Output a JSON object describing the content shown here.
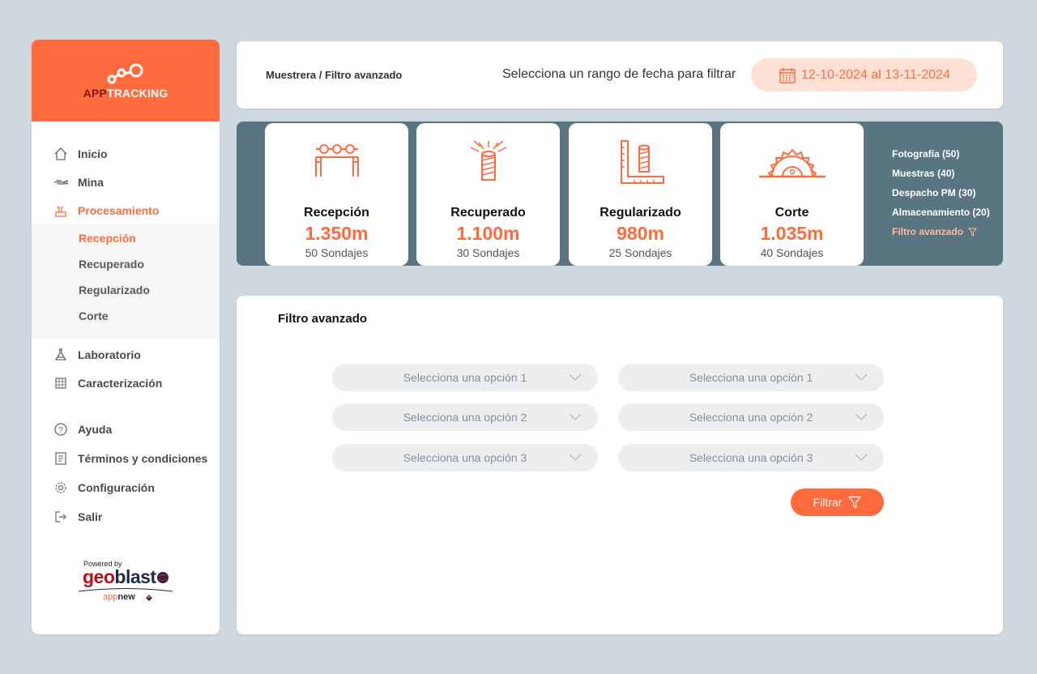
{
  "brand": {
    "name_part1": "APP",
    "name_part2": "TRACKING"
  },
  "nav": {
    "items": [
      {
        "label": "Inicio",
        "icon": "home-icon"
      },
      {
        "label": "Mina",
        "icon": "mine-icon"
      },
      {
        "label": "Procesamiento",
        "icon": "processing-icon",
        "active": true
      },
      {
        "label": "Laboratorio",
        "icon": "flask-icon"
      },
      {
        "label": "Caracterización",
        "icon": "characterization-icon"
      },
      {
        "label": "Ayuda",
        "icon": "help-icon"
      },
      {
        "label": "Términos y condiciones",
        "icon": "document-icon"
      },
      {
        "label": "Configuración",
        "icon": "gear-icon"
      },
      {
        "label": "Salir",
        "icon": "logout-icon"
      }
    ],
    "sub_items": [
      {
        "label": "Recepción",
        "active": true
      },
      {
        "label": "Recuperado"
      },
      {
        "label": "Regularizado"
      },
      {
        "label": "Corte"
      }
    ]
  },
  "powered": {
    "by": "Powered by",
    "geo1": "geo",
    "geo2": "blast",
    "app1": "app",
    "app2": "new"
  },
  "header": {
    "breadcrumb": "Muestrera / Filtro avanzado",
    "date_label": "Selecciona un rango de fecha para filtrar",
    "date_range": "12-10-2024 al 13-11-2024"
  },
  "stats": {
    "cards": [
      {
        "title": "Recepción",
        "value": "1.350m",
        "sub": "50 Sondajes",
        "icon": "reception-icon"
      },
      {
        "title": "Recuperado",
        "value": "1.100m",
        "sub": "30 Sondajes",
        "icon": "recovered-icon"
      },
      {
        "title": "Regularizado",
        "value": "980m",
        "sub": "25 Sondajes",
        "icon": "regularized-icon"
      },
      {
        "title": "Corte",
        "value": "1.035m",
        "sub": "40 Sondajes",
        "icon": "saw-icon"
      }
    ],
    "side_links": [
      "Fotografía (50)",
      "Muestras (40)",
      "Despacho PM (30)",
      "Almacenamiento (20)"
    ],
    "advanced_link": "Filtro avanzado"
  },
  "filter": {
    "title": "Filtro avanzado",
    "left_selects": [
      "Selecciona una opción 1",
      "Selecciona una opción 2",
      "Selecciona una opción 3"
    ],
    "right_selects": [
      "Selecciona una opción 1",
      "Selecciona una opción 2",
      "Selecciona una opción 3"
    ],
    "button": "Filtrar"
  },
  "colors": {
    "accent": "#ff6b3d",
    "band": "#5a7582",
    "background": "#d0d8df"
  }
}
